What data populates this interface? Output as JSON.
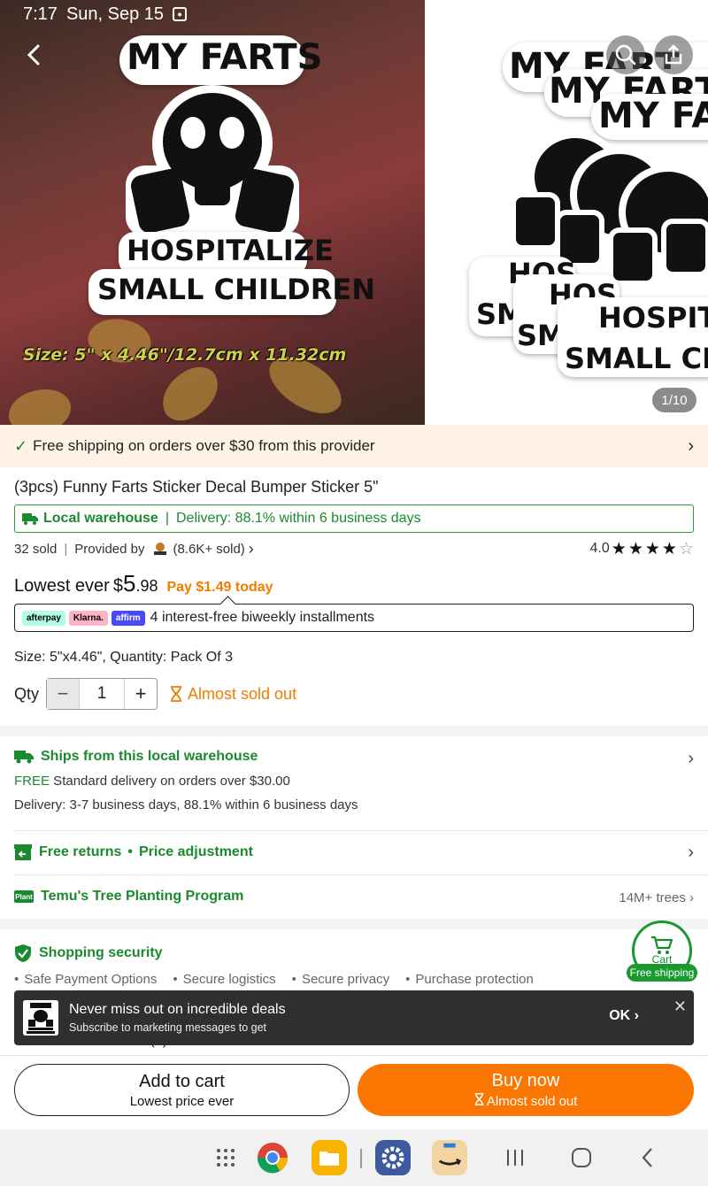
{
  "status_bar": {
    "time": "7:17",
    "date": "Sun, Sep 15"
  },
  "gallery": {
    "counter": "1/10",
    "sticker_top": "MY FARTS",
    "sticker_bottom_1": "HOSPITALIZE",
    "sticker_bottom_2": "SMALL CHILDREN",
    "size_caption": "Size: 5\" x 4.46\"/12.7cm x 11.32cm",
    "second_top_1": "MY FART",
    "second_top_2": "MY FARTS",
    "second_top_3": "MY FA",
    "second_bottom_1": "HOSPITA",
    "second_bottom_2": "SMALL CH",
    "second_bottom_3": "HOS",
    "second_bottom_4": "SMA",
    "second_bottom_5": "HOS",
    "second_bottom_6": "SMA"
  },
  "shipping_banner": "Free shipping on orders over $30 from this provider",
  "product": {
    "title": "(3pcs) Funny Farts Sticker Decal Bumper Sticker 5\"",
    "warehouse_label": "Local warehouse",
    "delivery_note": "Delivery: 88.1% within 6 business days",
    "sold": "32 sold",
    "provided_by": "Provided by",
    "provider_sold": "(8.6K+ sold)",
    "rating": "4.0",
    "stars": 4,
    "price_label": "Lowest ever",
    "price_currency": "$",
    "price_int": "5",
    "price_cents": ".98",
    "pay_today": "Pay $1.49 today",
    "installments": "4 interest-free biweekly installments",
    "pay_badges": [
      "afterpay",
      "Klarna.",
      "affirm"
    ],
    "size_quantity": "Size: 5\"x4.46\", Quantity: Pack Of 3",
    "qty_label": "Qty",
    "qty_value": "1",
    "almost_sold_out": "Almost sold out"
  },
  "delivery_section": {
    "heading": "Ships from this local warehouse",
    "free_label": "FREE",
    "free_text": " Standard delivery on orders over $30.00",
    "delivery_text": "Delivery: 3-7 business days, 88.1% within 6 business days"
  },
  "returns": {
    "label": "Free returns",
    "bullet": "•",
    "price_adj": "Price adjustment"
  },
  "tree": {
    "badge": "Plant",
    "label": "Temu's Tree Planting Program",
    "count": "14M+ trees"
  },
  "security": {
    "heading": "Shopping security",
    "items": [
      "Safe Payment Options",
      "Secure logistics",
      "Secure privacy",
      "Purchase protection"
    ]
  },
  "cart_float": {
    "label": "Cart",
    "tag": "Free shipping"
  },
  "review_peek": {
    "rating": "4.0",
    "count": "(3)"
  },
  "toast": {
    "title": "Never miss out on incredible deals",
    "subtitle": "Subscribe to marketing messages to get",
    "ok": "OK",
    "close": "✕"
  },
  "bottom": {
    "add_to_cart": "Add to cart",
    "add_sub": "Lowest price ever",
    "buy_now": "Buy now",
    "buy_sub": "Almost sold out"
  },
  "colors": {
    "accent_orange": "#fb7701",
    "green": "#1a8a2e",
    "banner_bg": "#fff3e6"
  }
}
